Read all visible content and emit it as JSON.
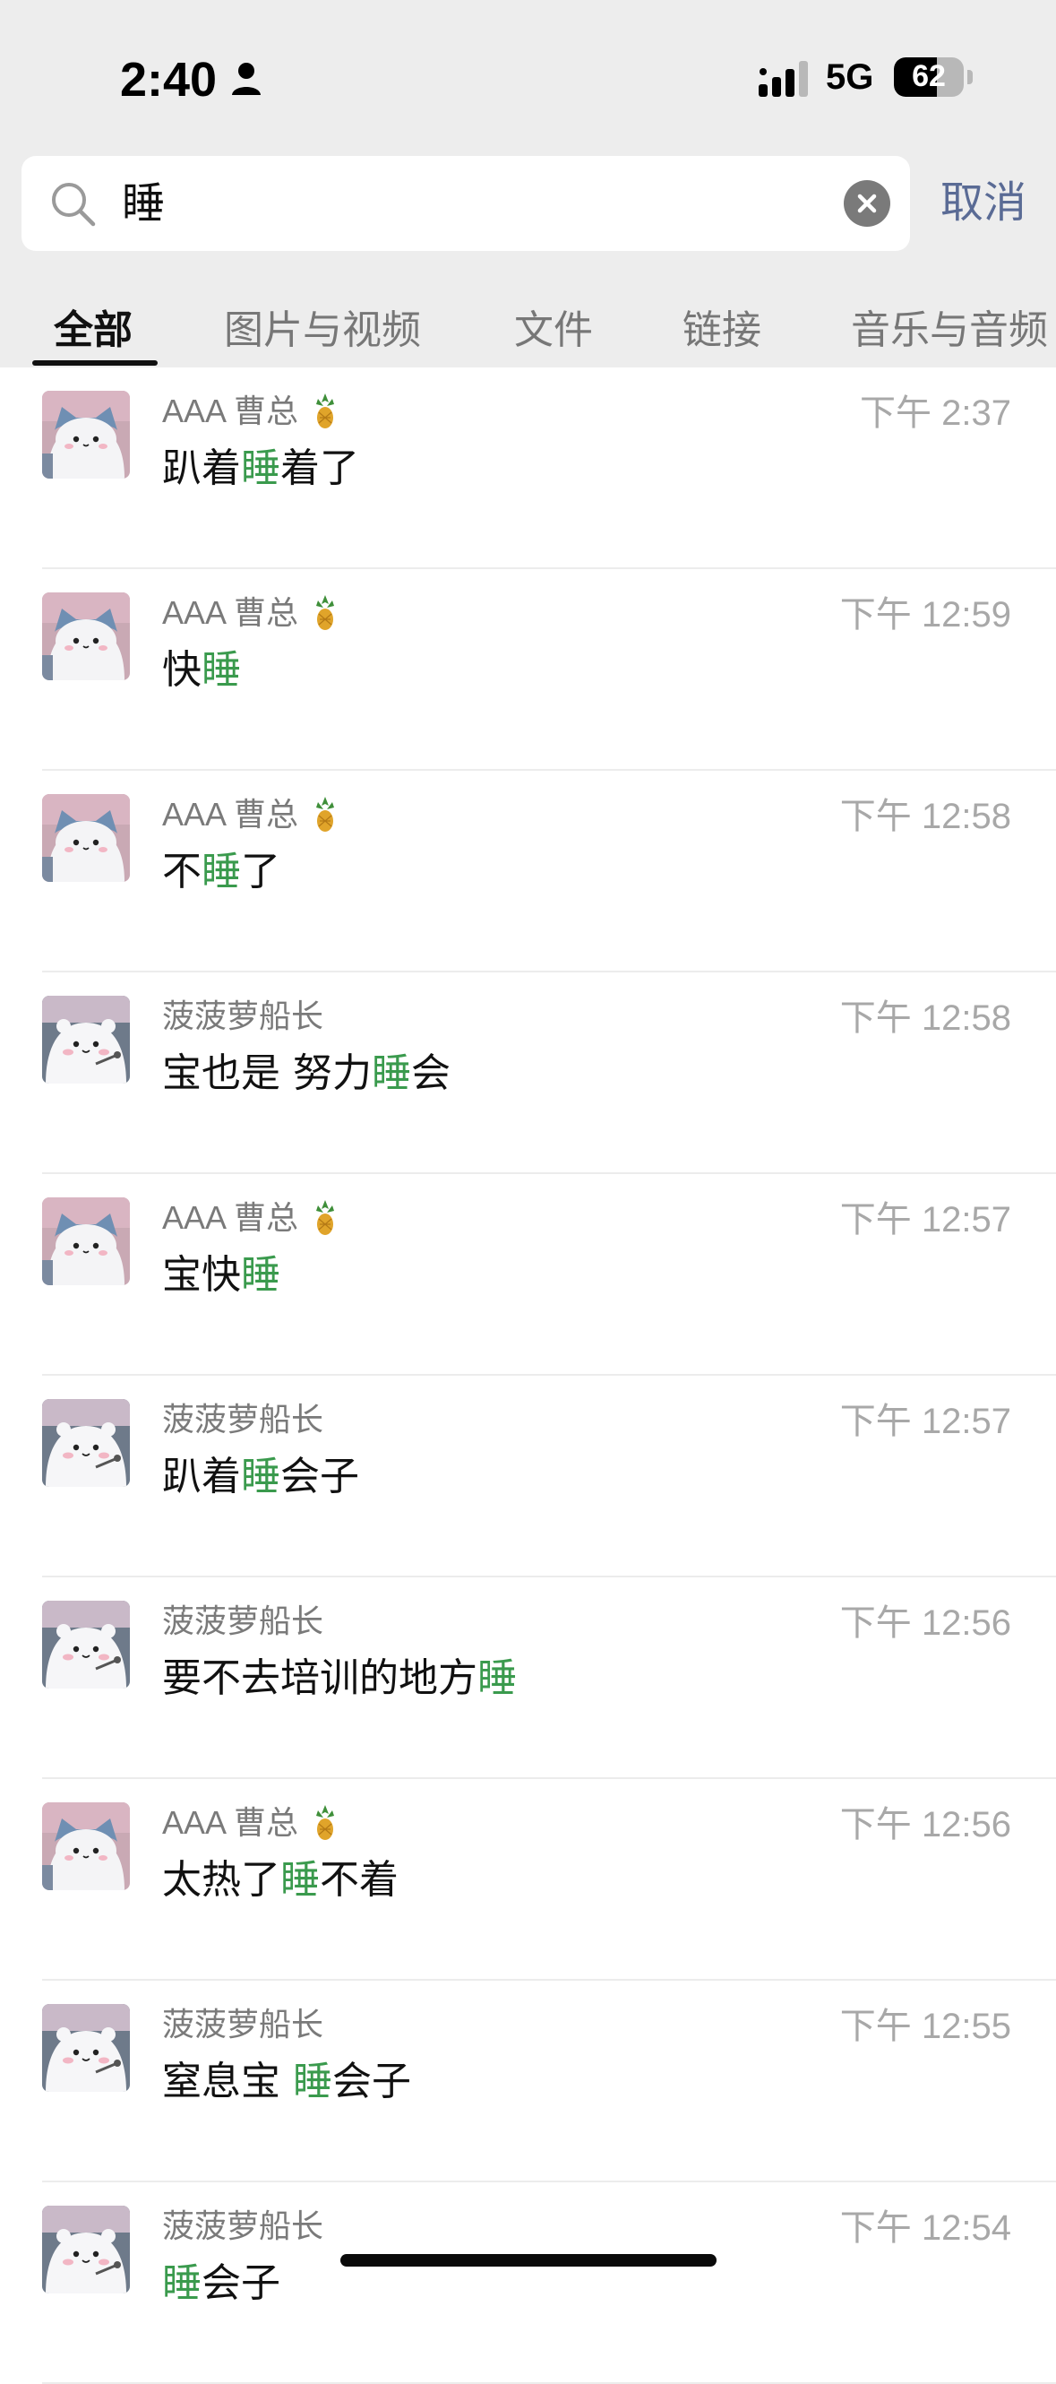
{
  "status_bar": {
    "time": "2:40",
    "network": "5G",
    "battery": "62",
    "battery_level": 0.62
  },
  "search": {
    "query": "睡",
    "cancel_label": "取消"
  },
  "tabs": [
    {
      "label": "全部",
      "active": true
    },
    {
      "label": "图片与视频"
    },
    {
      "label": "文件"
    },
    {
      "label": "链接"
    },
    {
      "label": "音乐与音频"
    }
  ],
  "colors": {
    "highlight": "#3a9a4d",
    "accent": "#5a6b95",
    "header_bg": "#ededed"
  },
  "results": [
    {
      "sender": "AAA 曹总",
      "pineapple": true,
      "avatar": "cat-avatar",
      "time": "下午 2:37",
      "pre": "趴着",
      "hl": "睡",
      "post": "着了"
    },
    {
      "sender": "AAA 曹总",
      "pineapple": true,
      "avatar": "cat-avatar",
      "time": "下午 12:59",
      "pre": "快",
      "hl": "睡",
      "post": ""
    },
    {
      "sender": "AAA 曹总",
      "pineapple": true,
      "avatar": "cat-avatar",
      "time": "下午 12:58",
      "pre": "不",
      "hl": "睡",
      "post": "了"
    },
    {
      "sender": "菠菠萝船长",
      "pineapple": false,
      "avatar": "hamster-avatar",
      "time": "下午 12:58",
      "pre": "宝也是 努力",
      "hl": "睡",
      "post": "会"
    },
    {
      "sender": "AAA 曹总",
      "pineapple": true,
      "avatar": "cat-avatar",
      "time": "下午 12:57",
      "pre": "宝快",
      "hl": "睡",
      "post": ""
    },
    {
      "sender": "菠菠萝船长",
      "pineapple": false,
      "avatar": "hamster-avatar",
      "time": "下午 12:57",
      "pre": "趴着",
      "hl": "睡",
      "post": "会子"
    },
    {
      "sender": "菠菠萝船长",
      "pineapple": false,
      "avatar": "hamster-avatar",
      "time": "下午 12:56",
      "pre": "要不去培训的地方",
      "hl": "睡",
      "post": ""
    },
    {
      "sender": "AAA 曹总",
      "pineapple": true,
      "avatar": "cat-avatar",
      "time": "下午 12:56",
      "pre": "太热了",
      "hl": "睡",
      "post": "不着"
    },
    {
      "sender": "菠菠萝船长",
      "pineapple": false,
      "avatar": "hamster-avatar",
      "time": "下午 12:55",
      "pre": "窒息宝 ",
      "hl": "睡",
      "post": "会子"
    },
    {
      "sender": "菠菠萝船长",
      "pineapple": false,
      "avatar": "hamster-avatar",
      "time": "下午 12:54",
      "pre": "",
      "hl": "睡",
      "post": "会子"
    }
  ]
}
